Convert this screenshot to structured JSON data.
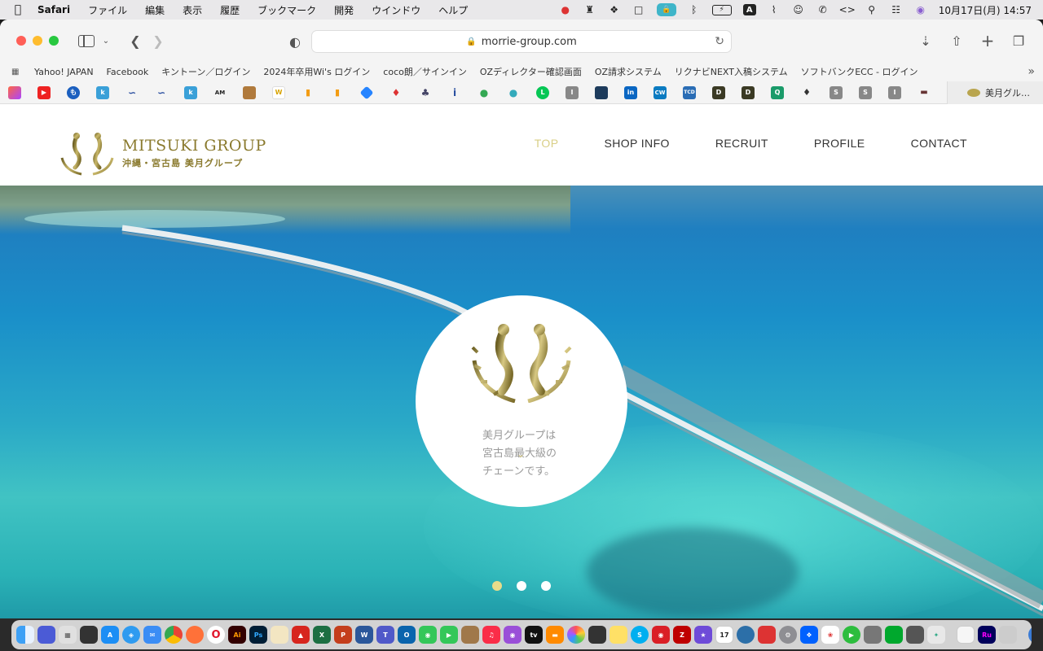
{
  "menubar": {
    "app_name": "Safari",
    "items": [
      "ファイル",
      "編集",
      "表示",
      "履歴",
      "ブックマーク",
      "開発",
      "ウインドウ",
      "ヘルプ"
    ],
    "datetime": "10月17日(月)  14:57"
  },
  "browser": {
    "url": "morrie-group.com",
    "bookmarks": [
      "Yahoo! JAPAN",
      "Facebook",
      "キントーン／ログイン",
      "2024年卒用Wi's ログイン",
      "coco朗／サインイン",
      "OZディレクター確認画面",
      "OZ請求システム",
      "リクナビNEXT入稿システム",
      "ソフトバンクECC - ログイン"
    ],
    "active_tab_title": "美月グル…"
  },
  "site": {
    "logo_en": "MITSUKI GROUP",
    "logo_jp": "沖縄・宮古島 美月グループ",
    "nav": [
      "TOP",
      "SHOP INFO",
      "RECRUIT",
      "PROFILE",
      "CONTACT"
    ],
    "tagline": [
      "美月グループは",
      "宮古島最大級の",
      "チェーンです。"
    ],
    "slider": {
      "count": 3,
      "active_index": 0
    }
  },
  "colors": {
    "brand_gold": "#8a7a2e",
    "nav_active": "#d9cf86",
    "sea": "#1a8fc9"
  },
  "favorites_icons": [
    "shortcuts-icon",
    "youtube-icon",
    "moneyforward-icon",
    "kintone-icon",
    "wave-icon",
    "wave2-icon",
    "kintone2-icon",
    "ame-icon",
    "photo-icon",
    "w-icon",
    "analytics-icon",
    "analytics2-icon",
    "jira-icon",
    "tag-icon",
    "tree-icon",
    "info-icon",
    "maps-icon",
    "pin-icon",
    "line-icon",
    "i-icon",
    "chart-icon",
    "linkedin-icon",
    "cw-icon",
    "tcd-icon",
    "d-icon",
    "d2-icon",
    "q-icon",
    "camel-icon",
    "s-icon",
    "s2-icon",
    "i2-icon",
    "book-icon",
    "cube-icon"
  ]
}
